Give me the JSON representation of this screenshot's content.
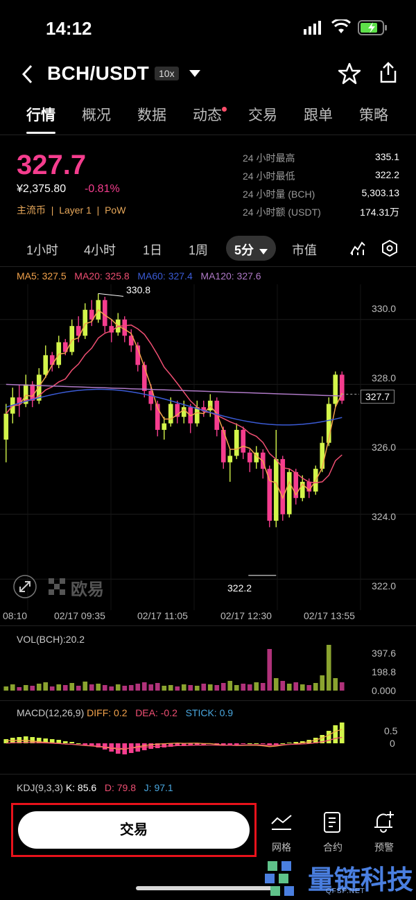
{
  "status": {
    "time": "14:12"
  },
  "header": {
    "pair": "BCH/USDT",
    "leverage": "10x"
  },
  "tabs": [
    {
      "label": "行情"
    },
    {
      "label": "概况"
    },
    {
      "label": "数据"
    },
    {
      "label": "动态"
    },
    {
      "label": "交易"
    },
    {
      "label": "跟单"
    },
    {
      "label": "策略"
    }
  ],
  "ticker": {
    "price": "327.7",
    "cny": "¥2,375.80",
    "change": "-0.81%",
    "tags": "主流币  |  Layer 1  |  PoW",
    "stats": [
      {
        "label": "24 小时最高",
        "value": "335.1"
      },
      {
        "label": "24 小时最低",
        "value": "322.2"
      },
      {
        "label": "24 小时量 (BCH)",
        "value": "5,303.13"
      },
      {
        "label": "24 小时额 (USDT)",
        "value": "174.31万"
      }
    ]
  },
  "intervals": [
    {
      "label": "1小时"
    },
    {
      "label": "4小时"
    },
    {
      "label": "1日"
    },
    {
      "label": "1周"
    },
    {
      "label": "5分"
    },
    {
      "label": "市值"
    }
  ],
  "ma": {
    "ma5": "MA5: 327.5",
    "ma20": "MA20: 325.8",
    "ma60": "MA60: 327.4",
    "ma120": "MA120: 327.6"
  },
  "colors": {
    "up": "#d3f54a",
    "down": "#f53d8e",
    "ma5": "#f3a24b",
    "ma20": "#f04f73",
    "ma60": "#3b5bd6",
    "ma120": "#b07ac8"
  },
  "chart_data": {
    "type": "candlestick",
    "y_ticks": [
      "330.0",
      "328.0",
      "326.0",
      "324.0",
      "322.0"
    ],
    "ylim": [
      321.6,
      331.0
    ],
    "x_ticks": [
      "08:10",
      "02/17 09:35",
      "02/17 11:05",
      "02/17 12:30",
      "02/17 13:55"
    ],
    "high_label": "330.8",
    "low_label": "322.2",
    "last_price": "327.7",
    "watermark": "欧易",
    "candles": [
      [
        326.3,
        327.1,
        325.6,
        327.4
      ],
      [
        327.1,
        327.6,
        326.8,
        327.9
      ],
      [
        327.6,
        327.4,
        327.0,
        328.0
      ],
      [
        327.4,
        328.0,
        327.3,
        328.3
      ],
      [
        328.0,
        327.5,
        327.3,
        328.1
      ],
      [
        327.5,
        328.3,
        327.4,
        328.5
      ],
      [
        328.3,
        328.9,
        328.2,
        329.2
      ],
      [
        328.9,
        328.6,
        328.4,
        329.0
      ],
      [
        328.6,
        329.3,
        328.5,
        329.5
      ],
      [
        329.3,
        329.0,
        328.9,
        329.4
      ],
      [
        329.0,
        329.8,
        328.9,
        330.0
      ],
      [
        329.8,
        329.5,
        329.3,
        330.1
      ],
      [
        329.5,
        330.3,
        329.4,
        330.5
      ],
      [
        330.3,
        330.0,
        329.8,
        330.6
      ],
      [
        330.0,
        330.6,
        329.9,
        330.8
      ],
      [
        330.6,
        329.8,
        329.6,
        330.7
      ],
      [
        329.8,
        329.6,
        329.3,
        330.0
      ],
      [
        329.6,
        330.0,
        329.5,
        330.2
      ],
      [
        330.0,
        329.5,
        329.3,
        330.1
      ],
      [
        329.5,
        329.2,
        329.0,
        329.7
      ],
      [
        329.2,
        328.6,
        328.4,
        329.3
      ],
      [
        328.6,
        327.8,
        327.6,
        328.7
      ],
      [
        327.8,
        327.4,
        327.2,
        328.0
      ],
      [
        327.4,
        326.6,
        326.4,
        327.5
      ],
      [
        326.6,
        326.8,
        326.3,
        327.0
      ],
      [
        326.8,
        327.4,
        326.7,
        327.6
      ],
      [
        327.4,
        327.0,
        326.8,
        327.5
      ],
      [
        327.0,
        327.3,
        326.8,
        327.5
      ],
      [
        327.3,
        326.8,
        326.5,
        327.4
      ],
      [
        326.8,
        327.3,
        326.7,
        327.5
      ],
      [
        327.3,
        327.2,
        327.0,
        327.5
      ],
      [
        327.2,
        327.5,
        327.0,
        327.7
      ],
      [
        327.5,
        326.6,
        326.4,
        327.6
      ],
      [
        326.6,
        325.6,
        325.4,
        326.7
      ],
      [
        325.6,
        325.8,
        325.0,
        326.0
      ],
      [
        325.8,
        326.6,
        325.7,
        326.8
      ],
      [
        326.6,
        325.9,
        325.7,
        326.7
      ],
      [
        325.9,
        325.6,
        325.3,
        326.0
      ],
      [
        325.6,
        325.9,
        325.4,
        326.1
      ],
      [
        325.9,
        325.4,
        325.1,
        326.0
      ],
      [
        325.4,
        323.8,
        323.6,
        325.5
      ],
      [
        323.8,
        325.7,
        323.6,
        326.6
      ],
      [
        325.7,
        324.0,
        323.8,
        325.8
      ],
      [
        324.0,
        325.3,
        323.9,
        325.4
      ],
      [
        325.3,
        324.5,
        324.3,
        325.4
      ],
      [
        324.5,
        325.0,
        324.4,
        325.2
      ],
      [
        325.0,
        324.7,
        324.5,
        325.1
      ],
      [
        324.7,
        325.4,
        324.6,
        325.5
      ],
      [
        325.4,
        326.2,
        325.3,
        326.4
      ],
      [
        326.2,
        327.4,
        326.1,
        327.6
      ],
      [
        327.4,
        328.3,
        327.3,
        328.4
      ],
      [
        328.3,
        327.5,
        327.4,
        328.4
      ]
    ]
  },
  "volume": {
    "label": "VOL(BCH):20.2",
    "ticks": [
      "397.6",
      "198.8",
      "0.000"
    ]
  },
  "macd": {
    "label": "MACD(12,26,9)",
    "diff": "DIFF: 0.2",
    "dea": "DEA: -0.2",
    "stick": "STICK: 0.9",
    "ticks": [
      "0.5",
      "0"
    ]
  },
  "kdj": {
    "label": "KDJ(9,3,3)",
    "k": "K: 85.6",
    "d": "D: 79.8",
    "j": "J: 97.1"
  },
  "bottom": {
    "trade": "交易",
    "tools": [
      {
        "label": "网格",
        "icon": "grid-chart-icon"
      },
      {
        "label": "合约",
        "icon": "contract-doc-icon"
      },
      {
        "label": "预警",
        "icon": "bell-plus-icon"
      }
    ]
  },
  "watermark2": {
    "text": "量链科技",
    "sub": "QFSP.NET"
  }
}
